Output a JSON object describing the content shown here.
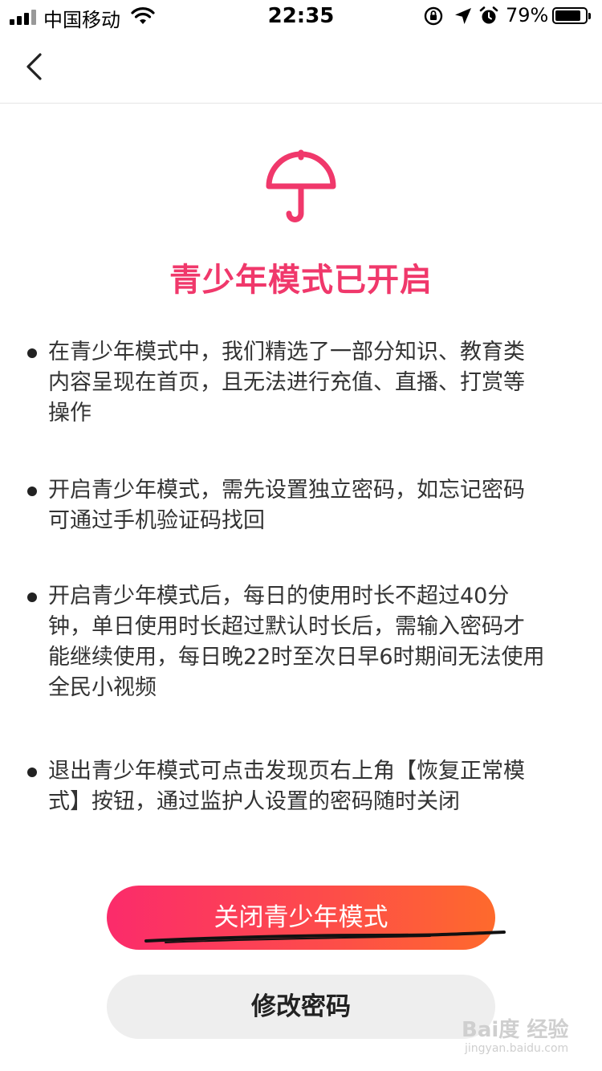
{
  "status_bar": {
    "carrier": "中国移动",
    "time": "22:35",
    "battery_percent": "79%",
    "battery_level": 0.79,
    "icons": [
      "signal-icon",
      "wifi-icon",
      "rotation-lock-icon",
      "location-icon",
      "alarm-icon",
      "battery-icon"
    ]
  },
  "nav": {
    "back_icon": "chevron-left-icon"
  },
  "header": {
    "icon": "umbrella-icon",
    "title": "青少年模式已开启",
    "accent_color": "#f0386b"
  },
  "bullets": [
    {
      "lines": [
        "在青少年模式中，我们精选了一部分知识、教育类",
        "内容呈现在首页，且无法进行充值、直播、打赏等",
        "操作"
      ]
    },
    {
      "lines": [
        "开启青少年模式，需先设置独立密码，如忘记密码",
        "可通过手机验证码找回"
      ]
    },
    {
      "lines": [
        "开启青少年模式后，每日的使用时长不超过40分",
        "钟，单日使用时长超过默认时长后，需输入密码才",
        "能继续使用，每日晚22时至次日早6时期间无法使用",
        "全民小视频"
      ]
    },
    {
      "lines": [
        "退出青少年模式可点击发现页右上角【恢复正常模",
        "式】按钮，通过监护人设置的密码随时关闭"
      ]
    }
  ],
  "buttons": {
    "close_mode": "关闭青少年模式",
    "change_password": "修改密码",
    "primary_gradient": [
      "#fb2b6b",
      "#fe6a2c"
    ]
  },
  "watermark": {
    "main": "Bai度 经验",
    "sub": "jingyan.baidu.com"
  }
}
